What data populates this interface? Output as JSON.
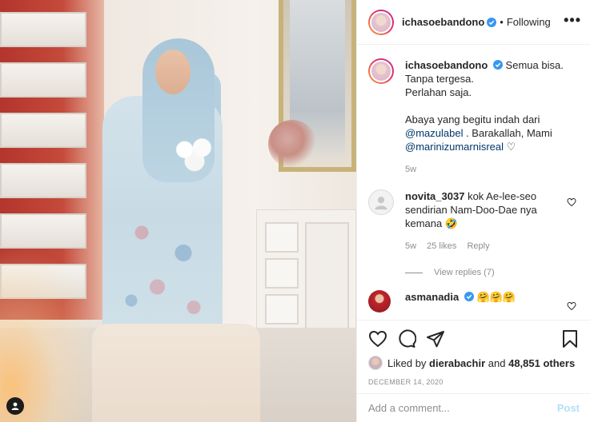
{
  "post": {
    "username": "ichasoebandono",
    "separator": "•",
    "follow_label": "Following",
    "more_label": "•••"
  },
  "caption": {
    "username": "ichasoebandono",
    "line1": "Semua bisa.",
    "line2": "Tanpa tergesa.",
    "line3": "Perlahan saja.",
    "line4_text": "Abaya yang begitu indah dari",
    "mention1": "@mazulabel",
    "line5_text": ". Barakallah, Mami",
    "mention2": "@marinizumarnisreal",
    "heart_glyph": "♡",
    "time": "5w"
  },
  "comments": [
    {
      "username": "novita_3037",
      "text": "kok Ae-lee-seo sendirian Nam-Doo-Dae nya kemana 🤣",
      "time": "5w",
      "likes": "25 likes",
      "reply_label": "Reply",
      "view_replies": "View replies (7)"
    },
    {
      "username": "asmanadia",
      "text": "🤗🤗🤗"
    }
  ],
  "likes": {
    "prefix": "Liked by",
    "liker": "dierabachir",
    "suffix_and": "and",
    "others": "48,851 others"
  },
  "date": "DECEMBER 14, 2020",
  "composer": {
    "placeholder": "Add a comment...",
    "post_label": "Post"
  },
  "colors": {
    "accent_blue": "#0095f6",
    "post_disabled": "#b2dffc",
    "mention": "#00376b",
    "muted": "#8e8e8e"
  },
  "icons": [
    "verified-badge-icon",
    "heart-icon",
    "comment-icon",
    "share-icon",
    "bookmark-icon",
    "user-tag-icon"
  ]
}
